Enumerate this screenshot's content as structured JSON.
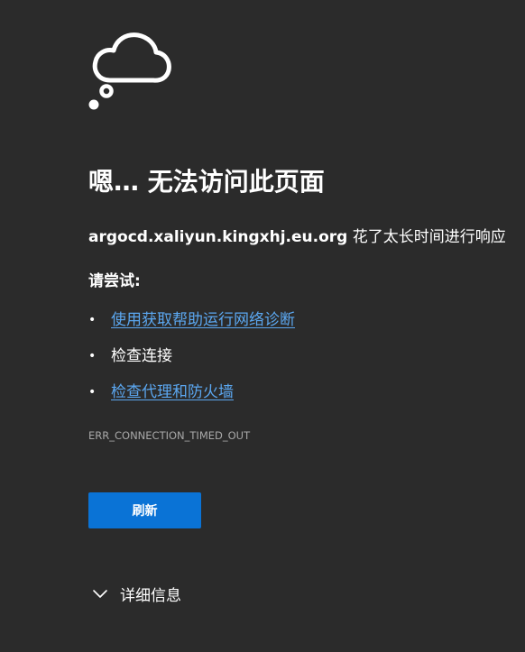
{
  "icons": {
    "error": "thought-cloud-icon",
    "chevron": "chevron-down-icon"
  },
  "error_page": {
    "title": "嗯… 无法访问此页面",
    "host": "argocd.xaliyun.kingxhj.eu.org",
    "message_suffix": "花了太长时间进行响应",
    "try_heading": "请尝试:",
    "suggestions": [
      {
        "label": "使用获取帮助运行网络诊断",
        "is_link": true
      },
      {
        "label": "检查连接",
        "is_link": false
      },
      {
        "label": "检查代理和防火墙",
        "is_link": true
      }
    ],
    "error_code": "ERR_CONNECTION_TIMED_OUT",
    "refresh_label": "刷新",
    "details_label": "详细信息"
  },
  "colors": {
    "background": "#2b2b2b",
    "link": "#5ba7f0",
    "button": "#0a73d6",
    "muted_text": "#a8a8a8"
  }
}
